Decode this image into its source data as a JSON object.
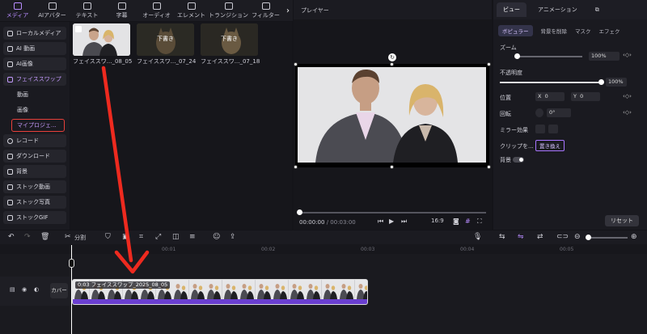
{
  "toolbar": {
    "tabs": [
      {
        "label": "メディア",
        "icon": "media-icon",
        "active": true
      },
      {
        "label": "AIアバター",
        "icon": "avatar-icon"
      },
      {
        "label": "テキスト",
        "icon": "text-icon"
      },
      {
        "label": "字幕",
        "icon": "caption-icon"
      },
      {
        "label": "オーディオ",
        "icon": "audio-icon"
      },
      {
        "label": "エレメント",
        "icon": "element-icon"
      },
      {
        "label": "トランジション",
        "icon": "transition-icon"
      },
      {
        "label": "フィルター",
        "icon": "filter-icon"
      }
    ],
    "more": "›"
  },
  "sidebar": {
    "items": [
      {
        "label": "ローカルメディア"
      },
      {
        "label": "AI 動画"
      },
      {
        "label": "AI画像"
      },
      {
        "label": "フェイススワップ",
        "active": true
      },
      {
        "label": "動画"
      },
      {
        "label": "画像"
      },
      {
        "label": "マイプロジェ..."
      },
      {
        "label": "レコード"
      },
      {
        "label": "ダウンロード"
      },
      {
        "label": "背景"
      },
      {
        "label": "ストック動画"
      },
      {
        "label": "ストック写真"
      },
      {
        "label": "ストックGIF"
      }
    ]
  },
  "media": {
    "items": [
      {
        "label": "フェイススワ..._08_05",
        "tag": ""
      },
      {
        "label": "フェイススワ..._07_24",
        "tag": "下書き"
      },
      {
        "label": "フェイススワ..._07_18",
        "tag": "下書き"
      }
    ]
  },
  "player": {
    "title": "プレイヤー",
    "current_time": "00:00:00",
    "separator": "/",
    "total_time": "00:03:00",
    "aspect": "16:9"
  },
  "inspector": {
    "tabs": [
      "ビュー",
      "アニメーション"
    ],
    "subtabs": [
      "ボピュラー",
      "背景を削除",
      "マスク",
      "エフェク"
    ],
    "zoom_label": "ズーム",
    "zoom_value": "100%",
    "zoom_fraction": 1.0,
    "opacity_label": "不透明度",
    "opacity_value": "100%",
    "opacity_fraction": 1.0,
    "position_label": "位置",
    "pos_x_label": "X",
    "pos_x": "0",
    "pos_y_label": "Y",
    "pos_y": "0",
    "rotate_label": "回転",
    "rotate_value": "0°",
    "mirror_label": "ミラー効果",
    "clip_label": "クリップを...",
    "replace_button": "置き換え",
    "background_label": "背景",
    "reset_button": "リセット"
  },
  "timeline": {
    "split_label": "分割",
    "ticks": [
      "00:01",
      "00:02",
      "00:03",
      "00:04",
      "00:05"
    ],
    "cover_label": "カバー",
    "clip_label": "0:03 フェイススワップ_2025_08_05"
  },
  "colors": {
    "accent": "#a875ff",
    "highlight_red": "#e8403a",
    "clip_bar": "#6a3fd0"
  }
}
